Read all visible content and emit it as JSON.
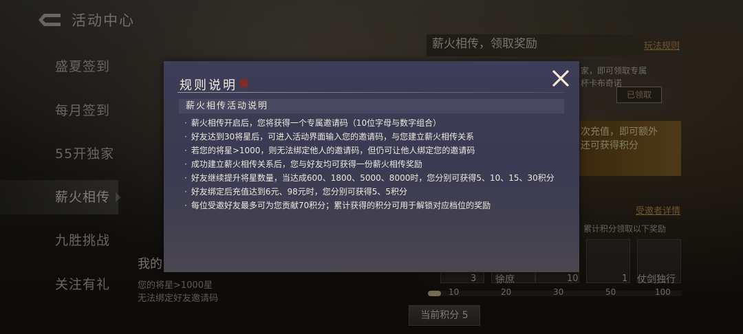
{
  "header": {
    "title": "活动中心"
  },
  "sidebar": {
    "items": [
      {
        "label": "盛夏签到"
      },
      {
        "label": "每月签到"
      },
      {
        "label": "55开独家"
      },
      {
        "label": "薪火相传"
      },
      {
        "label": "九胜挑战"
      },
      {
        "label": "关注有礼"
      }
    ],
    "active_index": 3
  },
  "panel": {
    "heading": "薪火相传，领取奖励",
    "rules_link": "玩法规则",
    "card1_text_line1": "家，即可领取专属",
    "card1_text_line2": "杯卡布奇诺",
    "claimed_badge": "已领取",
    "card2_text_line1": "次充值，即可额外",
    "card2_text_line2": "还可获得积分",
    "invitee_detail_link": "受邀者详情",
    "reward_hint": "累计积分领取以下奖励",
    "reward_counts": [
      "3",
      "10",
      "1"
    ],
    "reward_names": [
      "徐庶",
      "仗剑独行"
    ],
    "progress_ticks": [
      "10",
      "20",
      "30",
      "50",
      "100"
    ],
    "progress_fraction": 0.05,
    "current_score": "当前积分 5"
  },
  "left_info": {
    "my_text": "我的",
    "star_line1": "您的将星>1000星",
    "star_line2": "无法绑定好友邀请码"
  },
  "modal": {
    "title": "规则说明",
    "section_title": "薪火相传活动说明",
    "rules": [
      "薪火相传开启后，您将获得一个专属邀请码（10位字母与数字组合）",
      "好友达到30将星后，可进入活动界面输入您的邀请码，与您建立薪火相传关系",
      "若您的将星>1000，则无法绑定他人的邀请码，但仍可让他人绑定您的邀请码",
      "成功建立薪火相传关系后，您与好友均可获得一份薪火相传奖励",
      "好友继续提升将星数量，当达成600、1800、5000、8000时，您分别可获得5、10、15、30积分",
      "好友绑定后充值达到6元、98元时，您分别可获得5、5积分",
      "每位受邀好友最多可为您贡献70积分；累计获得的积分可用于解锁对应档位的奖励"
    ]
  },
  "colors": {
    "accent_gold": "#c99b54",
    "modal_bg": "#3e3d58"
  }
}
